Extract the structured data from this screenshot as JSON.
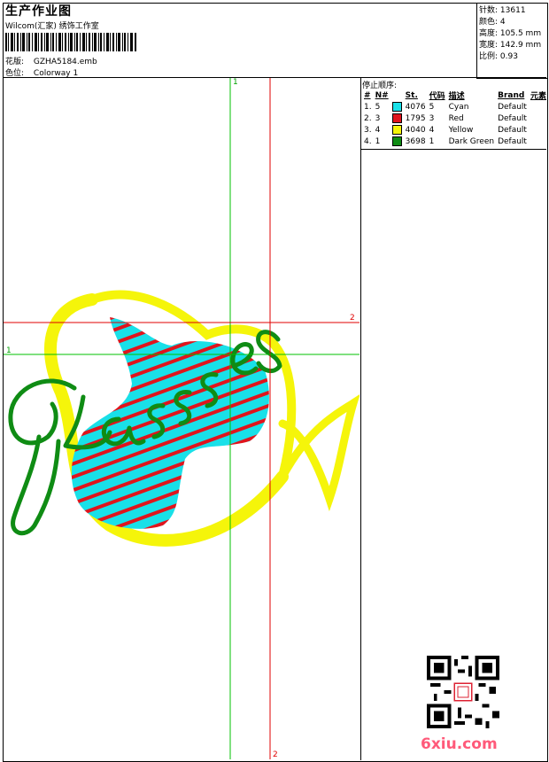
{
  "header": {
    "title": "生产作业图",
    "company": "Wilcom(汇家) 绣饰工作室",
    "design_label": "花版:",
    "design_value": "GZHA5184.emb",
    "colorway_label": "色位:",
    "colorway_value": "Colorway 1"
  },
  "stats": [
    {
      "label": "针数:",
      "value": "13611"
    },
    {
      "label": "颜色:",
      "value": "4"
    },
    {
      "label": "高度:",
      "value": "105.5 mm"
    },
    {
      "label": "宽度:",
      "value": "142.9 mm"
    },
    {
      "label": "比例:",
      "value": "0.93"
    }
  ],
  "stop_sequence": {
    "title": "停止顺序:",
    "columns": [
      "#",
      "N#",
      "St.",
      "代码",
      "描述",
      "Brand",
      "元素"
    ],
    "rows": [
      {
        "idx": "1.",
        "n": "5",
        "color": "#19e0e8",
        "st": "4076",
        "code": "5",
        "desc": "Cyan",
        "brand": "Default"
      },
      {
        "idx": "2.",
        "n": "3",
        "color": "#e0141c",
        "st": "1795",
        "code": "3",
        "desc": "Red",
        "brand": "Default"
      },
      {
        "idx": "3.",
        "n": "4",
        "color": "#f5f50a",
        "st": "4040",
        "code": "4",
        "desc": "Yellow",
        "brand": "Default"
      },
      {
        "idx": "4.",
        "n": "1",
        "color": "#0f8c14",
        "st": "3698",
        "code": "1",
        "desc": "Dark Green",
        "brand": "Default"
      }
    ]
  },
  "guides": {
    "v1": "1",
    "h2": "2",
    "h1": "1",
    "v2": "2"
  },
  "embroidery_text": "Glasses",
  "watermark": "6xiu.com",
  "colors": {
    "cyan": "#19e0e8",
    "red": "#e0141c",
    "yellow": "#f5f50a",
    "green": "#0f8c14",
    "guide_green": "#00c000",
    "guide_red": "#e00000"
  }
}
